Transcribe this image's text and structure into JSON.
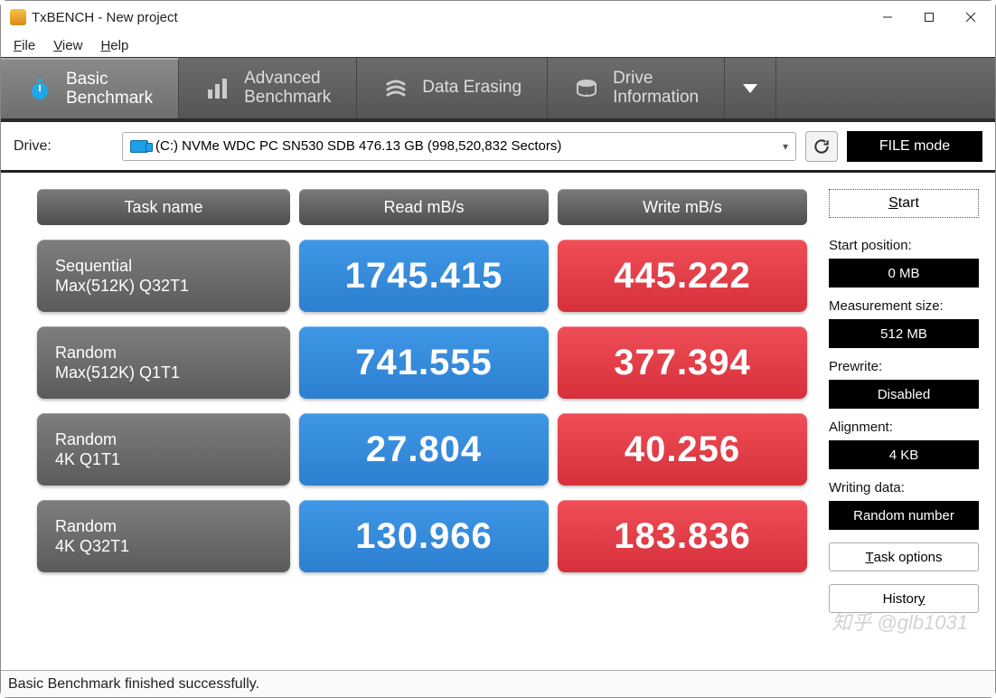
{
  "window": {
    "title": "TxBENCH - New project"
  },
  "menu": {
    "file": "File",
    "view": "View",
    "help": "Help"
  },
  "tabs": {
    "basic": "Basic\nBenchmark",
    "advanced": "Advanced\nBenchmark",
    "erase": "Data Erasing",
    "drive": "Drive\nInformation"
  },
  "drive": {
    "label": "Drive:",
    "value": "(C:) NVMe WDC PC SN530 SDB  476.13 GB (998,520,832 Sectors)",
    "filemode": "FILE mode"
  },
  "headers": {
    "task": "Task name",
    "read": "Read mB/s",
    "write": "Write mB/s"
  },
  "rows": [
    {
      "name1": "Sequential",
      "name2": "Max(512K) Q32T1",
      "read": "1745.415",
      "write": "445.222"
    },
    {
      "name1": "Random",
      "name2": "Max(512K) Q1T1",
      "read": "741.555",
      "write": "377.394"
    },
    {
      "name1": "Random",
      "name2": "4K Q1T1",
      "read": "27.804",
      "write": "40.256"
    },
    {
      "name1": "Random",
      "name2": "4K Q32T1",
      "read": "130.966",
      "write": "183.836"
    }
  ],
  "side": {
    "start": "Start",
    "startpos_label": "Start position:",
    "startpos": "0 MB",
    "meas_label": "Measurement size:",
    "meas": "512 MB",
    "prewrite_label": "Prewrite:",
    "prewrite": "Disabled",
    "align_label": "Alignment:",
    "align": "4 KB",
    "wdata_label": "Writing data:",
    "wdata": "Random number",
    "taskopt": "Task options",
    "history": "History"
  },
  "status": "Basic Benchmark finished successfully.",
  "watermark": "知乎 @glb1031",
  "chart_data": {
    "type": "table",
    "title": "TxBENCH Basic Benchmark Results",
    "columns": [
      "Task name",
      "Read mB/s",
      "Write mB/s"
    ],
    "rows": [
      [
        "Sequential Max(512K) Q32T1",
        1745.415,
        445.222
      ],
      [
        "Random Max(512K) Q1T1",
        741.555,
        377.394
      ],
      [
        "Random 4K Q1T1",
        27.804,
        40.256
      ],
      [
        "Random 4K Q32T1",
        130.966,
        183.836
      ]
    ]
  }
}
